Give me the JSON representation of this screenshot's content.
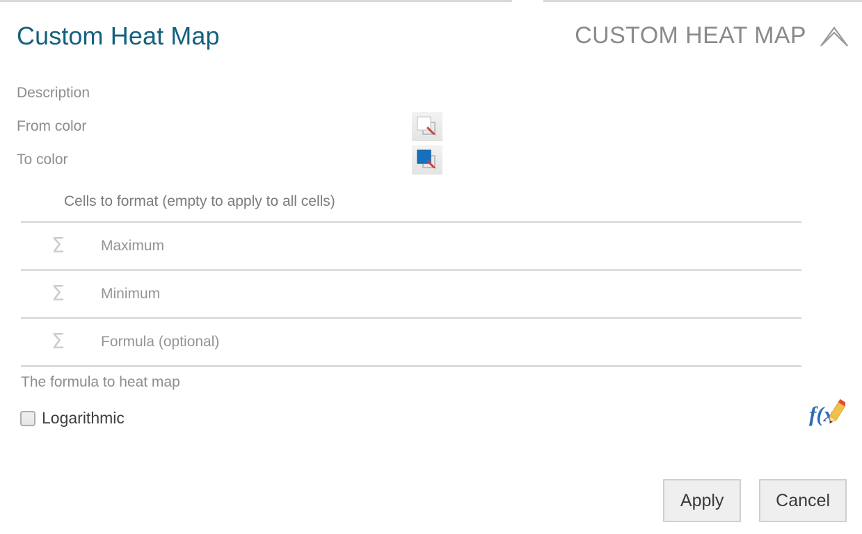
{
  "header": {
    "title": "Custom Heat Map",
    "caption": "CUSTOM HEAT MAP",
    "collapse_icon": "chevron-up-icon",
    "title_color": "#15607f",
    "caption_color": "#8a8a8a"
  },
  "fields": {
    "description_placeholder": "Description",
    "from_color_label": "From color",
    "to_color_label": "To color",
    "from_color_value": "#ffffff",
    "to_color_value": "#1570c0",
    "group_label": "Cells to format (empty to apply to all cells)",
    "rows": [
      {
        "icon": "sigma-icon",
        "placeholder": "Maximum",
        "value": ""
      },
      {
        "icon": "sigma-icon",
        "placeholder": "Minimum",
        "value": ""
      },
      {
        "icon": "sigma-icon",
        "placeholder": "Formula (optional)",
        "value": ""
      }
    ],
    "help_text": "The formula to heat map"
  },
  "options": {
    "logarithmic_label": "Logarithmic",
    "logarithmic_checked": false
  },
  "formula_editor": {
    "icon": "fx-pencil-icon",
    "fx_text": "f(x",
    "fx_color": "#2f6db5",
    "pencil_color": "#f2c14b"
  },
  "footer": {
    "apply_label": "Apply",
    "cancel_label": "Cancel"
  }
}
